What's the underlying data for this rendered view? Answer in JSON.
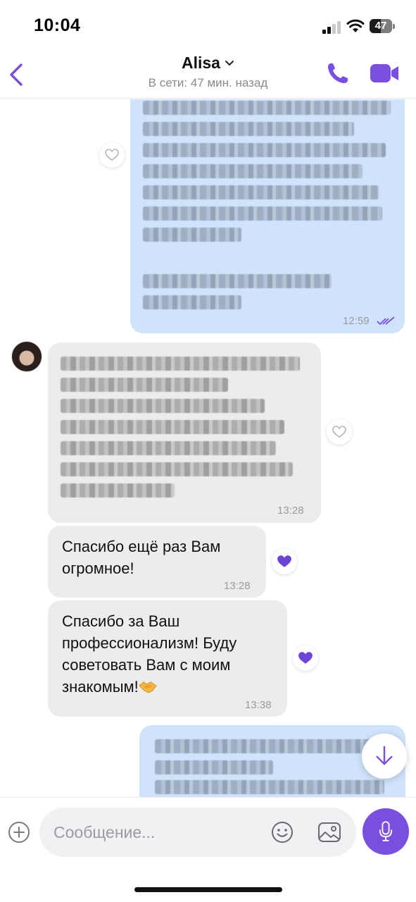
{
  "status_bar": {
    "time": "10:04",
    "battery": "47"
  },
  "header": {
    "contact_name": "Alisa",
    "presence": "В сети: 47 мин. назад",
    "icons": {
      "back": "chevron-left-icon",
      "call": "phone-icon",
      "video": "video-camera-icon"
    },
    "accent_color": "#7a4ee0"
  },
  "messages": [
    {
      "direction": "outgoing",
      "content": "blurred",
      "time": "12:59",
      "read": true,
      "liked": false
    },
    {
      "direction": "incoming",
      "content": "blurred",
      "time": "13:28",
      "liked": false
    },
    {
      "direction": "incoming",
      "text": "Спасибо ещё раз Вам\nогромное!",
      "time": "13:28",
      "liked": true
    },
    {
      "direction": "incoming",
      "text": "Спасибо за Ваш\nпрофессионализм! Буду\nсоветовать Вам с моим\nзнакомым!",
      "emoji": "handshake",
      "time": "13:38",
      "liked": true
    },
    {
      "direction": "outgoing",
      "content": "blurred"
    }
  ],
  "composer": {
    "placeholder": "Сообщение...",
    "icons": {
      "add": "plus-circle-icon",
      "sticker": "smiley-icon",
      "gallery": "gallery-icon",
      "voice": "microphone-icon"
    }
  },
  "colors": {
    "outgoing_bubble": "#cfe3fb",
    "incoming_bubble": "#ececec",
    "liked_heart": "#6c45d8"
  }
}
